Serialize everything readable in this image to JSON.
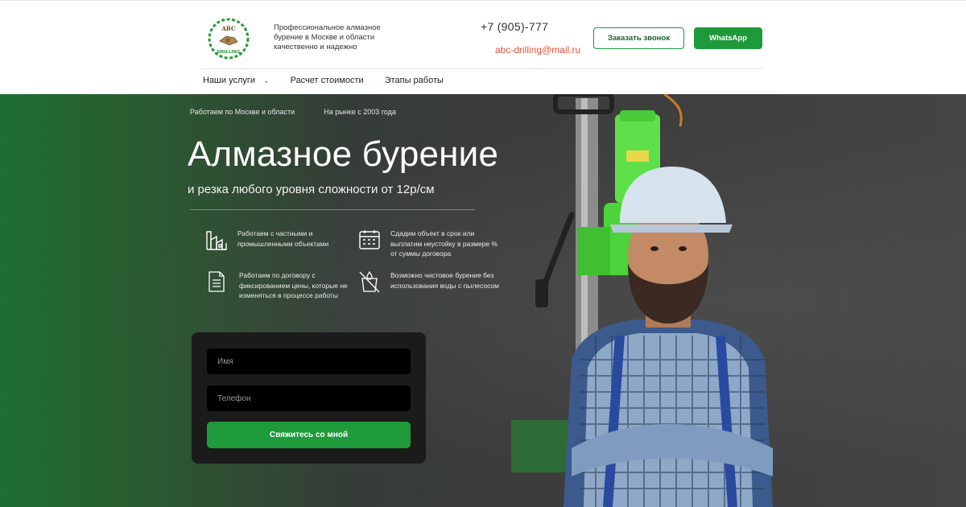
{
  "header": {
    "logo_text_top": "ABC",
    "logo_text_bottom": "DRILLING",
    "tagline": "Профессиональное алмазное бурение в Москве и области качественно и надежно",
    "phone": "+7 (905)-777",
    "email": "abc-drilling@mail.ru",
    "callback_label": "Заказать звонок",
    "whatsapp_label": "WhatsApp"
  },
  "nav": {
    "items": [
      {
        "label": "Наши услуги"
      },
      {
        "label": "Расчет стоимости"
      },
      {
        "label": "Этапы работы"
      }
    ]
  },
  "hero": {
    "facts": [
      "Работаем по Москве и области",
      "На рынке с 2003 года"
    ],
    "title": "Алмазное бурение",
    "subtitle": "и резка любого уровня сложности от 12р/см",
    "features": [
      {
        "icon": "factory-icon",
        "text": "Работаем с частными и промышленными объектами"
      },
      {
        "icon": "calendar-icon",
        "text": "Сдадим объект в срок или выплатим неустойку в размере % от суммы договора"
      },
      {
        "icon": "document-icon",
        "text": "Работаем по договору с фиксированием цены, которые не изменяться в процессе работы"
      },
      {
        "icon": "no-water-icon",
        "text": "Возможно чистовое бурение без использования воды с пылесосом"
      }
    ]
  },
  "form": {
    "name_placeholder": "Имя",
    "phone_placeholder": "Телефон",
    "submit_label": "Свяжитесь со мной"
  },
  "colors": {
    "accent": "#1e9a3a",
    "email": "#e8553c"
  }
}
